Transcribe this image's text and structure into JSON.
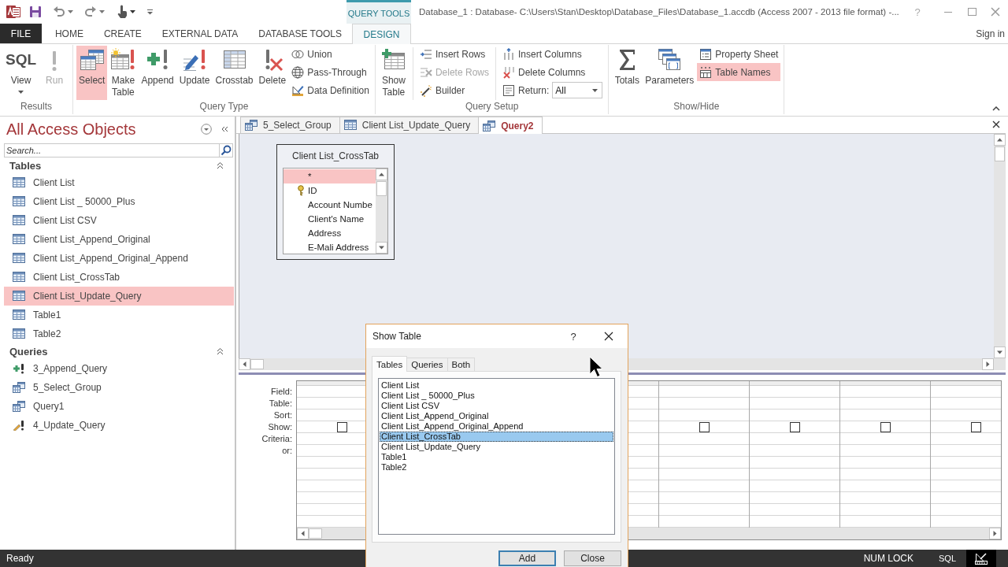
{
  "window": {
    "context_label": "QUERY TOOLS",
    "title": "Database_1 : Database- C:\\Users\\Stan\\Desktop\\Database_Files\\Database_1.accdb (Access 2007 - 2013 file format) -...",
    "help": "?"
  },
  "ribbon_tabs": [
    {
      "label": "FILE",
      "kind": "backstage",
      "selected": false
    },
    {
      "label": "HOME",
      "kind": "tab",
      "selected": false
    },
    {
      "label": "CREATE",
      "kind": "tab",
      "selected": false
    },
    {
      "label": "EXTERNAL DATA",
      "kind": "tab",
      "selected": false
    },
    {
      "label": "DATABASE TOOLS",
      "kind": "tab",
      "selected": false
    },
    {
      "label": "DESIGN",
      "kind": "contextual",
      "selected": true
    }
  ],
  "account": {
    "label": "Sign in"
  },
  "ribbon_groups": [
    {
      "label": "Results",
      "items": [
        {
          "kind": "large",
          "label": "View",
          "glyph": "SQL",
          "dropdown": true,
          "selected": false,
          "disabled": false
        },
        {
          "kind": "large",
          "label": "Run",
          "selected": false,
          "disabled": true
        }
      ]
    },
    {
      "label": "Query Type",
      "items": [
        {
          "kind": "large",
          "label": "Select",
          "selected": true,
          "disabled": false
        },
        {
          "kind": "large",
          "label": "Make Table",
          "selected": false,
          "disabled": false
        },
        {
          "kind": "large",
          "label": "Append",
          "selected": false,
          "disabled": false
        },
        {
          "kind": "large",
          "label": "Update",
          "selected": false,
          "disabled": false
        },
        {
          "kind": "large",
          "label": "Crosstab",
          "selected": false,
          "disabled": false
        },
        {
          "kind": "large",
          "label": "Delete",
          "selected": false,
          "disabled": false
        },
        {
          "kind": "stack",
          "items": [
            {
              "kind": "small",
              "label": "Union",
              "selected": false,
              "disabled": false
            },
            {
              "kind": "small",
              "label": "Pass-Through",
              "selected": false,
              "disabled": false
            },
            {
              "kind": "small",
              "label": "Data Definition",
              "selected": false,
              "disabled": false
            }
          ]
        }
      ]
    },
    {
      "label": "Query Setup",
      "items": [
        {
          "kind": "large",
          "label": "Show Table",
          "selected": false,
          "disabled": false
        },
        {
          "kind": "stack",
          "divider_before": true,
          "items": [
            {
              "kind": "small",
              "label": "Insert Rows",
              "selected": false,
              "disabled": false
            },
            {
              "kind": "small",
              "label": "Delete Rows",
              "selected": false,
              "disabled": true
            },
            {
              "kind": "small",
              "label": "Builder",
              "selected": false,
              "disabled": false
            }
          ]
        },
        {
          "kind": "stack",
          "divider_before": true,
          "items": [
            {
              "kind": "small",
              "label": "Insert Columns",
              "selected": false,
              "disabled": false
            },
            {
              "kind": "small",
              "label": "Delete Columns",
              "selected": false,
              "disabled": false
            },
            {
              "kind": "combo",
              "label": "Return:",
              "value": "All"
            }
          ]
        }
      ]
    },
    {
      "label": "Show/Hide",
      "items": [
        {
          "kind": "large",
          "label": "Totals",
          "selected": false,
          "disabled": false
        },
        {
          "kind": "large",
          "label": "Parameters",
          "selected": false,
          "disabled": false
        },
        {
          "kind": "stack",
          "items": [
            {
              "kind": "small",
              "label": "Property Sheet",
              "selected": false,
              "disabled": false
            },
            {
              "kind": "small",
              "label": "Table Names",
              "selected": true,
              "disabled": false
            }
          ]
        }
      ]
    }
  ],
  "navigation": {
    "title": "All Access Objects",
    "search": {
      "placeholder": "Search..."
    },
    "groups": [
      {
        "label": "Tables",
        "expanded": true,
        "items": [
          {
            "label": "Client List",
            "kind": "table",
            "selected": false
          },
          {
            "label": "Client List _ 50000_Plus",
            "kind": "table",
            "selected": false
          },
          {
            "label": "Client List CSV",
            "kind": "table",
            "selected": false
          },
          {
            "label": "Client List_Append_Original",
            "kind": "table",
            "selected": false
          },
          {
            "label": "Client List_Append_Original_Append",
            "kind": "table",
            "selected": false
          },
          {
            "label": "Client List_CrossTab",
            "kind": "table",
            "selected": false
          },
          {
            "label": "Client List_Update_Query",
            "kind": "table",
            "selected": true
          },
          {
            "label": "Table1",
            "kind": "table",
            "selected": false
          },
          {
            "label": "Table2",
            "kind": "table",
            "selected": false
          }
        ]
      },
      {
        "label": "Queries",
        "expanded": true,
        "items": [
          {
            "label": "3_Append_Query",
            "kind": "append",
            "selected": false
          },
          {
            "label": "5_Select_Group",
            "kind": "select",
            "selected": false
          },
          {
            "label": "Query1",
            "kind": "select",
            "selected": false
          },
          {
            "label": "4_Update_Query",
            "kind": "update",
            "selected": false
          }
        ]
      }
    ]
  },
  "document_tabs": [
    {
      "label": "5_Select_Group",
      "kind": "select",
      "selected": false
    },
    {
      "label": "Client List_Update_Query",
      "kind": "table",
      "selected": false
    },
    {
      "label": "Query2",
      "kind": "select",
      "selected": true
    }
  ],
  "query_design": {
    "table": {
      "title": "Client List_CrossTab",
      "fields": [
        {
          "label": "*",
          "key": false,
          "selected": true
        },
        {
          "label": "ID",
          "key": true,
          "selected": false
        },
        {
          "label": "Account Numbe",
          "key": false,
          "selected": false
        },
        {
          "label": "Client's Name",
          "key": false,
          "selected": false
        },
        {
          "label": "Address",
          "key": false,
          "selected": false
        },
        {
          "label": "E-Mali Address",
          "key": false,
          "selected": false
        }
      ]
    },
    "grid": {
      "row_labels": [
        "Field:",
        "Table:",
        "Sort:",
        "Show:",
        "Criteria:",
        "or:"
      ],
      "columns": [
        {
          "show": false
        },
        {},
        {},
        {},
        {
          "show": false
        },
        {
          "show": false
        },
        {
          "show": false
        },
        {
          "show": false
        }
      ]
    }
  },
  "dialog": {
    "title": "Show Table",
    "help": "?",
    "tabs": [
      {
        "label": "Tables",
        "selected": true
      },
      {
        "label": "Queries",
        "selected": false
      },
      {
        "label": "Both",
        "selected": false
      }
    ],
    "items": [
      {
        "label": "Client List",
        "selected": false
      },
      {
        "label": "Client List _ 50000_Plus",
        "selected": false
      },
      {
        "label": "Client List CSV",
        "selected": false
      },
      {
        "label": "Client List_Append_Original",
        "selected": false
      },
      {
        "label": "Client List_Append_Original_Append",
        "selected": false
      },
      {
        "label": "Client List_CrossTab",
        "selected": true
      },
      {
        "label": "Client List_Update_Query",
        "selected": false
      },
      {
        "label": "Table1",
        "selected": false
      },
      {
        "label": "Table2",
        "selected": false
      }
    ],
    "buttons": [
      {
        "label": "Add",
        "default": true
      },
      {
        "label": "Close",
        "default": false
      }
    ]
  },
  "status_bar": {
    "text": "Ready",
    "indicators": [
      "NUM LOCK"
    ],
    "views": [
      {
        "kind": "sql",
        "label": "SQL",
        "selected": false
      },
      {
        "kind": "design",
        "selected": true
      }
    ]
  }
}
